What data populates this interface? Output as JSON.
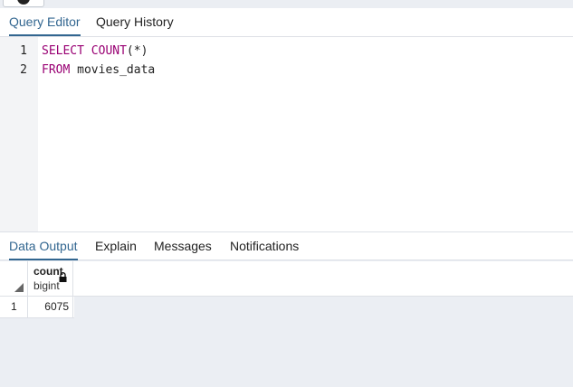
{
  "editor_tabs": [
    {
      "label": "Query Editor",
      "active": true
    },
    {
      "label": "Query History",
      "active": false
    }
  ],
  "query": {
    "lines": [
      {
        "number": "1",
        "keyword": "SELECT COUNT",
        "rest": "(*)"
      },
      {
        "number": "2",
        "keyword": "FROM",
        "rest": " movies_data"
      }
    ]
  },
  "output_tabs": [
    {
      "label": "Data Output",
      "active": true
    },
    {
      "label": "Explain",
      "active": false
    },
    {
      "label": "Messages",
      "active": false
    },
    {
      "label": "Notifications",
      "active": false
    }
  ],
  "result": {
    "columns": [
      {
        "name": "count",
        "type": "bigint"
      }
    ],
    "rows": [
      {
        "row_number": "1",
        "values": [
          "6075"
        ]
      }
    ]
  },
  "colors": {
    "active_tab": "#326690",
    "keyword": "#990073",
    "panel_background": "#ebeef3"
  }
}
